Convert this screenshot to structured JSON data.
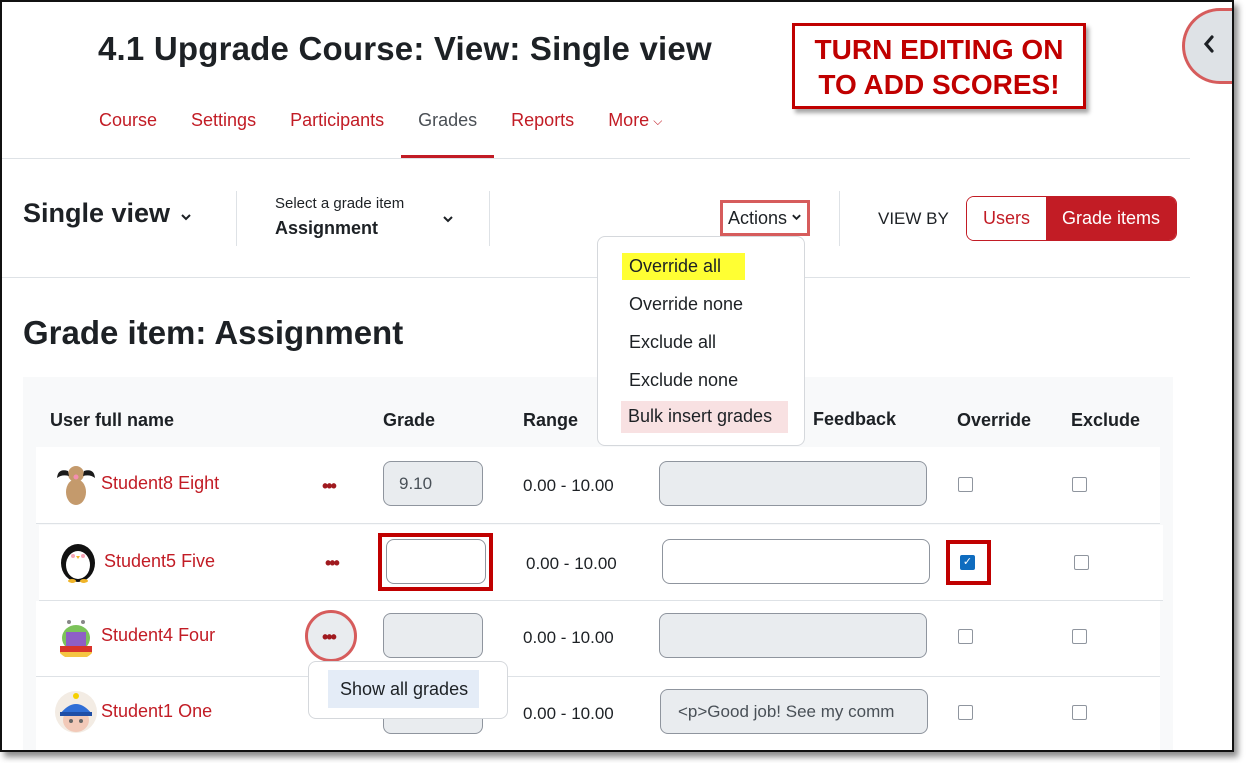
{
  "page": {
    "title": "4.1 Upgrade Course: View: Single view"
  },
  "course_nav": {
    "items": [
      {
        "label": "Course",
        "active": false
      },
      {
        "label": "Settings",
        "active": false
      },
      {
        "label": "Participants",
        "active": false
      },
      {
        "label": "Grades",
        "active": true
      },
      {
        "label": "Reports",
        "active": false
      },
      {
        "label": "More",
        "active": false
      }
    ],
    "more_chevron": "chevron-down-icon"
  },
  "callout": {
    "line1": "TURN EDITING ON",
    "line2": "TO ADD SCORES!"
  },
  "drawer_toggle": {
    "glyph": "‹"
  },
  "tertiary_nav": {
    "report_selector": "Single view",
    "grade_item_label": "Select a grade item",
    "grade_item_value": "Assignment",
    "actions_label": "Actions",
    "view_by_label": "VIEW BY",
    "view_by_options": [
      "Users",
      "Grade items"
    ],
    "view_by_selected": "Grade items"
  },
  "actions_menu": {
    "items": [
      {
        "label": "Override all",
        "highlight": "yellow"
      },
      {
        "label": "Override none",
        "highlight": null
      },
      {
        "label": "Exclude all",
        "highlight": null
      },
      {
        "label": "Exclude none",
        "highlight": null
      },
      {
        "label": "Bulk insert grades",
        "highlight": "pink"
      }
    ]
  },
  "grade_item": {
    "heading": "Grade item: Assignment"
  },
  "table": {
    "headers": [
      "User full name",
      "Grade",
      "Range",
      "Feedback",
      "Override",
      "Exclude"
    ],
    "rows": [
      {
        "name": "Student8 Eight",
        "avatar": "dog-avatar",
        "grade": "9.10",
        "grade_enabled": false,
        "range": "0.00 - 10.00",
        "feedback": "",
        "feedback_enabled": false,
        "override": false,
        "exclude": false
      },
      {
        "name": "Student5 Five",
        "avatar": "penguin-avatar",
        "grade": "",
        "grade_enabled": true,
        "range": "0.00 - 10.00",
        "feedback": "",
        "feedback_enabled": true,
        "override": true,
        "exclude": false
      },
      {
        "name": "Student4 Four",
        "avatar": "reading-monster-avatar",
        "grade": "",
        "grade_enabled": false,
        "range": "0.00 - 10.00",
        "feedback": "",
        "feedback_enabled": false,
        "override": false,
        "exclude": false
      },
      {
        "name": "Student1 One",
        "avatar": "monkey-helmet-avatar",
        "grade": "",
        "grade_enabled": false,
        "range": "0.00 - 10.00",
        "feedback": "<p>Good job! See my comm",
        "feedback_enabled": false,
        "override": false,
        "exclude": false
      }
    ],
    "row_menu_glyph": "•••"
  },
  "row_popover": {
    "item": "Show all grades"
  },
  "colors": {
    "brand_red": "#c21c25",
    "callout_red": "#c00000",
    "highlight_yellow": "#ffff33",
    "checkbox_blue": "#0f6cbf"
  }
}
